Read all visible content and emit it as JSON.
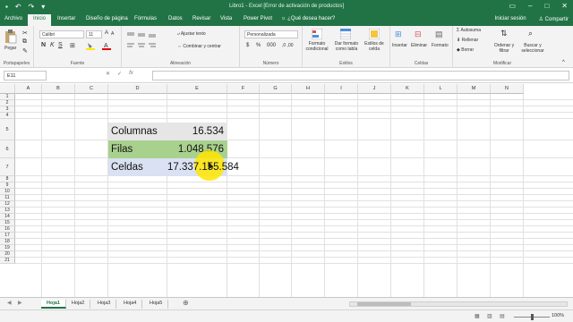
{
  "window": {
    "title": "Libro1 - Excel [Error de activación de productos]"
  },
  "ribbon_tabs": [
    {
      "label": "Archivo"
    },
    {
      "label": "Inicio"
    },
    {
      "label": "Insertar"
    },
    {
      "label": "Diseño de página"
    },
    {
      "label": "Fórmulas"
    },
    {
      "label": "Datos"
    },
    {
      "label": "Revisar"
    },
    {
      "label": "Vista"
    },
    {
      "label": "Power Pivot"
    }
  ],
  "tell_me": "¿Qué desea hacer?",
  "account": {
    "signin": "Iniciar sesión",
    "share": "Compartir"
  },
  "ribbon": {
    "clipboard": {
      "label": "Portapapeles",
      "paste": "Pegar"
    },
    "font": {
      "label": "Fuente",
      "name": "Calibri",
      "size": "11"
    },
    "alignment": {
      "label": "Alineación",
      "wrap": "Ajustar texto",
      "merge": "Combinar y centrar"
    },
    "number": {
      "label": "Número",
      "format": "Personalizada"
    },
    "styles": {
      "label": "Estilos",
      "cond": "Formato condicional",
      "table": "Dar formato como tabla",
      "cell": "Estilos de celda"
    },
    "cells": {
      "label": "Celdas",
      "insert": "Insertar",
      "delete": "Eliminar",
      "format": "Formato"
    },
    "editing": {
      "label": "Modificar",
      "autosum": "Autosuma",
      "fill": "Rellenar",
      "clear": "Borrar",
      "sort": "Ordenar y filtrar",
      "find": "Buscar y seleccionar"
    }
  },
  "formula_bar": {
    "name_box": "E11",
    "formula": ""
  },
  "grid": {
    "columns": [
      "A",
      "B",
      "C",
      "D",
      "E",
      "F",
      "G",
      "H",
      "I",
      "J",
      "K",
      "L",
      "M",
      "N"
    ],
    "rows": [
      "1",
      "2",
      "3",
      "4",
      "5",
      "6",
      "7",
      "8",
      "9",
      "10",
      "11",
      "12",
      "13",
      "14",
      "15",
      "16",
      "17",
      "18",
      "19",
      "20",
      "21"
    ]
  },
  "table": [
    {
      "label": "Columnas",
      "value": "16.534",
      "fill": "#e7e6e6"
    },
    {
      "label": "Filas",
      "value": "1.048.576",
      "fill": "#a9d18e"
    },
    {
      "label": "Celdas",
      "value": "17.337.155.584",
      "fill": "#d9e1f2"
    }
  ],
  "sheets": [
    {
      "label": "Hoja1",
      "active": true
    },
    {
      "label": "Hoja2"
    },
    {
      "label": "Hoja3"
    },
    {
      "label": "Hoja4"
    },
    {
      "label": "Hoja5"
    }
  ],
  "status": {
    "zoom": "100%"
  },
  "colors": {
    "accent": "#217346",
    "highlight": "#ffe600"
  }
}
